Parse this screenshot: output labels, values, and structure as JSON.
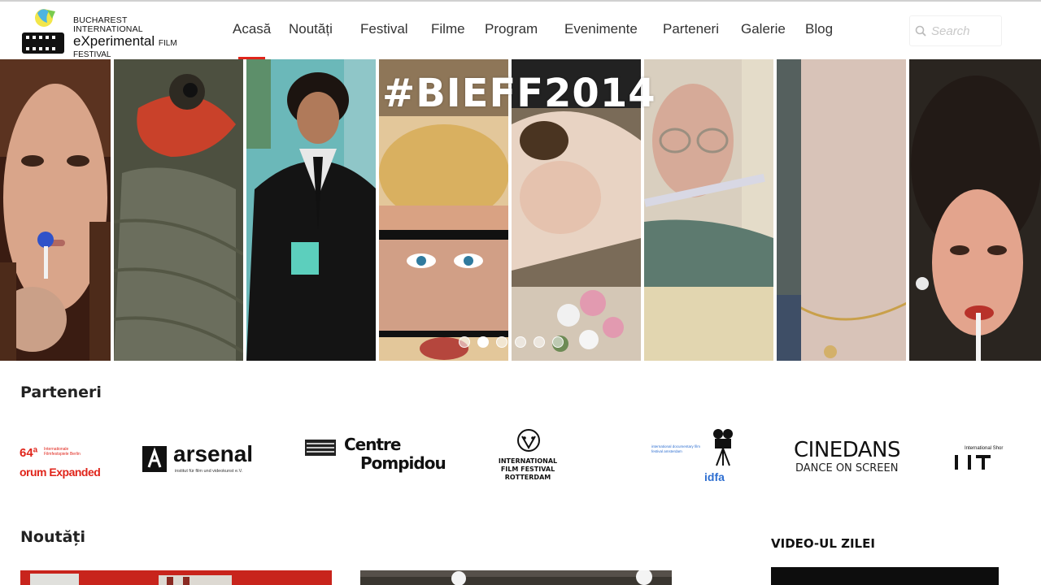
{
  "brand": {
    "line1": "BUCHAREST INTERNATIONAL",
    "line2_main": "eXperimental",
    "line2_small": "FILM",
    "line3": "FESTIVAL"
  },
  "nav": {
    "items": [
      {
        "label": "Acasă",
        "active": true
      },
      {
        "label": "Noutăți"
      },
      {
        "label": "Festival"
      },
      {
        "label": "Filme"
      },
      {
        "label": "Program"
      },
      {
        "label": "Evenimente"
      },
      {
        "label": "Parteneri"
      },
      {
        "label": "Galerie"
      },
      {
        "label": "Blog"
      }
    ],
    "active_color": "#e0251b"
  },
  "search": {
    "placeholder": "Search",
    "icon": "search-icon"
  },
  "hero": {
    "hashtag": "#BIEFF2014",
    "slide_count": 6,
    "active_slide": 2
  },
  "partners": {
    "title": "Parteneri",
    "logos": [
      {
        "name": "forum-expanded-logo",
        "text1": "64ª",
        "text2": "Internationale Filmfestspiele Berlin",
        "text3": "orum Expanded"
      },
      {
        "name": "arsenal-logo",
        "text1": "arsenal",
        "text2": "institut für film und videokunst e.V."
      },
      {
        "name": "centre-pompidou-logo",
        "text1": "Centre",
        "text2": "Pompidou"
      },
      {
        "name": "iffr-logo",
        "text1": "INTERNATIONAL",
        "text2": "FILM FESTIVAL",
        "text3": "ROTTERDAM"
      },
      {
        "name": "idfa-logo",
        "text1": "international documentary film festival amsterdam",
        "text2": "idfa"
      },
      {
        "name": "cinedans-logo",
        "text1": "CINEDANS",
        "text2": "DANCE ON SCREEN"
      },
      {
        "name": "international-short-logo",
        "text1": "International Shor"
      }
    ]
  },
  "news": {
    "title": "Noutăți"
  },
  "video": {
    "title": "VIDEO-UL ZILEI"
  },
  "colors": {
    "accent": "#e0251b",
    "text": "#222222"
  }
}
